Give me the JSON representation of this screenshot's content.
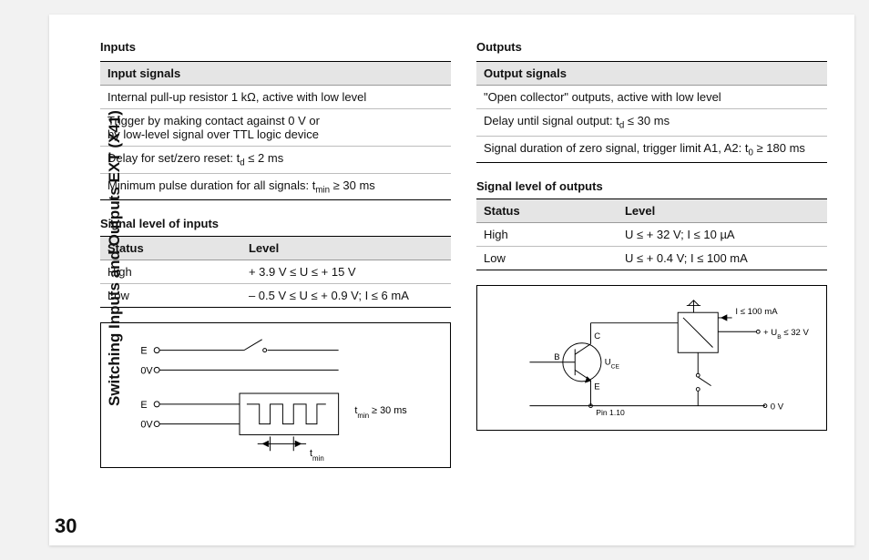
{
  "page_number": "30",
  "sidebar_title": "Switching Inputs and Outputs EXT (X41)",
  "left": {
    "heading": "Inputs",
    "table1_header": "Input signals",
    "table1_rows": [
      "Internal pull-up resistor 1 kΩ, active with low level",
      "Trigger by making contact against 0 V or\nby low-level signal over TTL logic device",
      "Delay for set/zero reset: t_d ≤ 2 ms",
      "Minimum pulse duration for all signals: t_min ≥ 30 ms"
    ],
    "sub_heading": "Signal level of inputs",
    "table2_headers": {
      "c1": "Status",
      "c2": "Level"
    },
    "table2_rows": [
      {
        "c1": "High",
        "c2": "+ 3.9 V ≤ U ≤ + 15 V"
      },
      {
        "c1": "Low",
        "c2": "– 0.5 V ≤ U ≤ + 0.9 V;  I ≤ 6 mA"
      }
    ],
    "diagram": {
      "E": "E",
      "zeroV": "0V",
      "tmin_label": "t_min ≥ 30 ms",
      "tmin_short": "t_min"
    }
  },
  "right": {
    "heading": "Outputs",
    "table1_header": "Output signals",
    "table1_rows": [
      "\"Open collector\" outputs, active with low level",
      "Delay until signal output: t_d ≤ 30 ms",
      "Signal duration of zero signal, trigger limit  A1, A2: t_0 ≥ 180 ms"
    ],
    "sub_heading": "Signal level of outputs",
    "table2_headers": {
      "c1": "Status",
      "c2": "Level"
    },
    "table2_rows": [
      {
        "c1": "High",
        "c2": "U ≤ + 32 V;  I ≤ 10 µA"
      },
      {
        "c1": "Low",
        "c2": "U ≤ + 0.4 V;  I ≤ 100 mA"
      }
    ],
    "diagram": {
      "I_label": "I ≤ 100 mA",
      "UB_label": "+ U_B ≤ 32 V",
      "UCE": "U_CE",
      "B": "B",
      "C": "C",
      "E": "E",
      "pin": "Pin 1.10",
      "zeroV": "0 V"
    }
  }
}
